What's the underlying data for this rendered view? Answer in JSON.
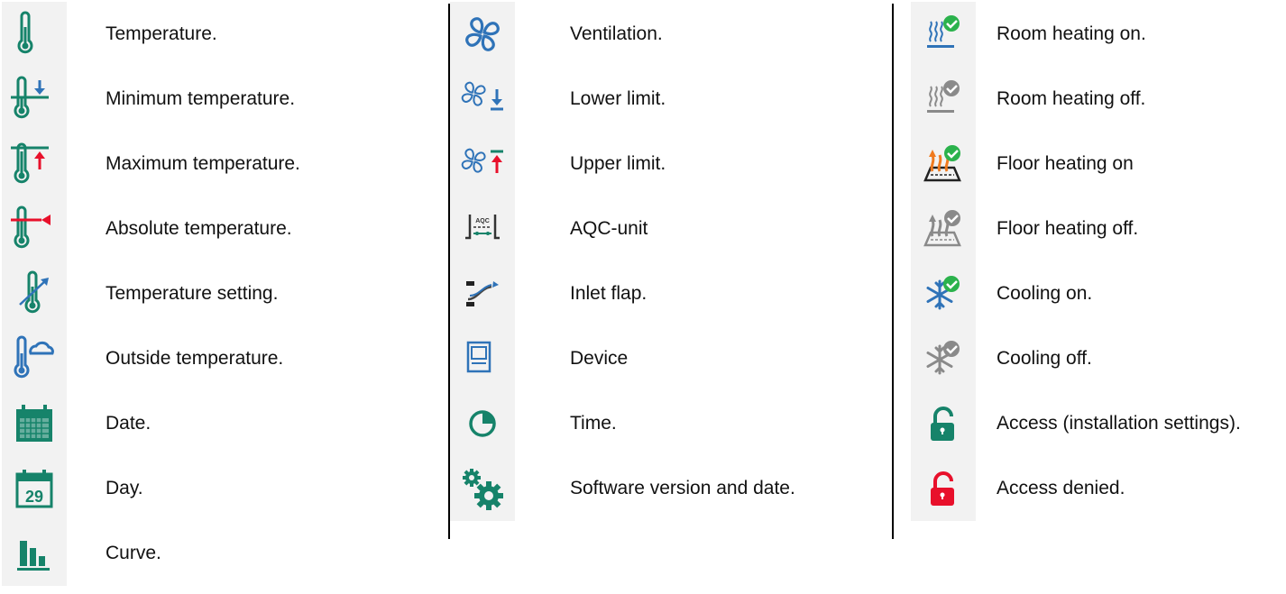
{
  "colors": {
    "teal": "#16836a",
    "blue": "#2f73b8",
    "red": "#e8102b",
    "orange": "#f07a1e",
    "check_green": "#2bb24c",
    "gray": "#8a8a8a",
    "tile_bg": "#f2f2f2"
  },
  "columns": [
    {
      "items": [
        {
          "icon": "thermometer-icon",
          "label": "Temperature."
        },
        {
          "icon": "thermometer-min-icon",
          "label": "Minimum temperature."
        },
        {
          "icon": "thermometer-max-icon",
          "label": "Maximum temperature."
        },
        {
          "icon": "thermometer-absolute-icon",
          "label": "Absolute temperature."
        },
        {
          "icon": "thermometer-setting-icon",
          "label": "Temperature setting."
        },
        {
          "icon": "outside-temperature-icon",
          "label": "Outside temperature."
        },
        {
          "icon": "calendar-icon",
          "label": "Date."
        },
        {
          "icon": "calendar-day-icon",
          "label": "Day.",
          "day_number": "29"
        },
        {
          "icon": "bar-chart-icon",
          "label": "Curve."
        }
      ]
    },
    {
      "items": [
        {
          "icon": "fan-icon",
          "label": "Ventilation."
        },
        {
          "icon": "fan-lower-limit-icon",
          "label": "Lower limit."
        },
        {
          "icon": "fan-upper-limit-icon",
          "label": "Upper limit."
        },
        {
          "icon": "aqc-unit-icon",
          "label": "AQC-unit",
          "badge": "AQC"
        },
        {
          "icon": "inlet-flap-icon",
          "label": "Inlet flap."
        },
        {
          "icon": "device-icon",
          "label": "Device"
        },
        {
          "icon": "clock-pie-icon",
          "label": "Time."
        },
        {
          "icon": "gears-icon",
          "label": "Software version and date."
        }
      ]
    },
    {
      "items": [
        {
          "icon": "room-heating-on-icon",
          "label": "Room heating on."
        },
        {
          "icon": "room-heating-off-icon",
          "label": "Room heating off."
        },
        {
          "icon": "floor-heating-on-icon",
          "label": "Floor heating on"
        },
        {
          "icon": "floor-heating-off-icon",
          "label": "Floor heating off."
        },
        {
          "icon": "cooling-on-icon",
          "label": "Cooling on."
        },
        {
          "icon": "cooling-off-icon",
          "label": "Cooling off."
        },
        {
          "icon": "unlock-icon",
          "label": "Access (installation settings)."
        },
        {
          "icon": "lock-denied-icon",
          "label": "Access denied."
        }
      ]
    }
  ]
}
